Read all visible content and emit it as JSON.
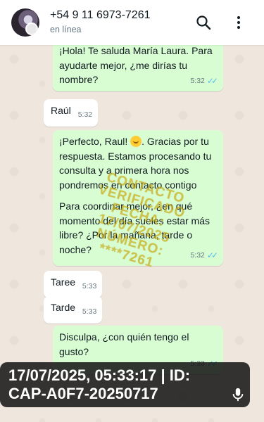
{
  "header": {
    "contact_name": "+54 9 11 6973-7261",
    "status": "en línea"
  },
  "messages": [
    {
      "dir": "out",
      "text": "¡Hola! Te saluda María Laura. Para ayudarte mejor, ¿me dirías tu nombre?",
      "time": "5:32",
      "read": true
    },
    {
      "dir": "in",
      "text": "Raúl",
      "time": "5:32"
    },
    {
      "dir": "out",
      "text_before_emoji": "¡Perfecto, Raul!",
      "emoji": "smiling-face",
      "text_after_emoji": ". Gracias por tu respuesta. Estamos procesando tu consulta y a primera hora nos pondremos en contacto contigo",
      "text_2": "Para coordinar mejor, ¿en qué momento del día sueles estar más libre? ¿Por la mañana, tarde o noche?",
      "time": "5:32",
      "read": true
    },
    {
      "dir": "in",
      "text": "Taree",
      "time": "5:33"
    },
    {
      "dir": "in",
      "text": "Tarde",
      "time": "5:33"
    },
    {
      "dir": "out",
      "text": "Disculpa, ¿con quién tengo el gusto?",
      "time": "5:33",
      "read": true
    }
  ],
  "watermark": {
    "line1": "CONTACTO",
    "line2": "VERIFICADO",
    "line3": "FECHA:",
    "line4": "17/07/2025",
    "line5": "NÚMERO:",
    "line6": "****7261"
  },
  "capture_stamp": {
    "line1": "17/07/2025, 05:33:17 | ID:",
    "line2": "CAP-A0F7-20250717"
  },
  "colors": {
    "outgoing_bubble": "#d9fdd3",
    "incoming_bubble": "#ffffff",
    "read_ticks": "#53bdeb",
    "chat_background": "#efe7de"
  },
  "icons": [
    "avatar",
    "search-icon",
    "more-vert-icon",
    "mic-icon",
    "read-receipt-icon",
    "smiling-face-emoji"
  ]
}
